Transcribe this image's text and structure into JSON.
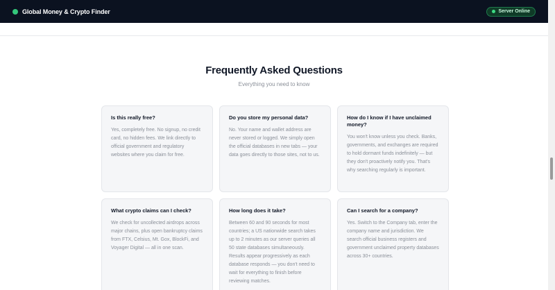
{
  "header": {
    "title": "Global Money & Crypto Finder",
    "status": "Server Online"
  },
  "faq": {
    "title": "Frequently Asked Questions",
    "subtitle": "Everything you need to know",
    "items": [
      {
        "question": "Is this really free?",
        "answer": "Yes, completely free. No signup, no credit card, no hidden fees. We link directly to official government and regulatory websites where you claim for free."
      },
      {
        "question": "Do you store my personal data?",
        "answer": "No. Your name and wallet address are never stored or logged. We simply open the official databases in new tabs — your data goes directly to those sites, not to us."
      },
      {
        "question": "How do I know if I have unclaimed money?",
        "answer": "You won't know unless you check. Banks, governments, and exchanges are required to hold dormant funds indefinitely — but they don't proactively notify you. That's why searching regularly is important."
      },
      {
        "question": "What crypto claims can I check?",
        "answer": "We check for uncollected airdrops across major chains, plus open bankruptcy claims from FTX, Celsius, Mt. Gox, BlockFi, and Voyager Digital — all in one scan."
      },
      {
        "question": "How long does it take?",
        "answer": "Between 60 and 90 seconds for most countries; a US nationwide search takes up to 2 minutes as our server queries all 50 state databases simultaneously. Results appear progressively as each database responds — you don't need to wait for everything to finish before reviewing matches."
      },
      {
        "question": "Can I search for a company?",
        "answer": "Yes. Switch to the Company tab, enter the company name and jurisdiction. We search official business registers and government unclaimed property databases across 30+ countries."
      }
    ]
  }
}
